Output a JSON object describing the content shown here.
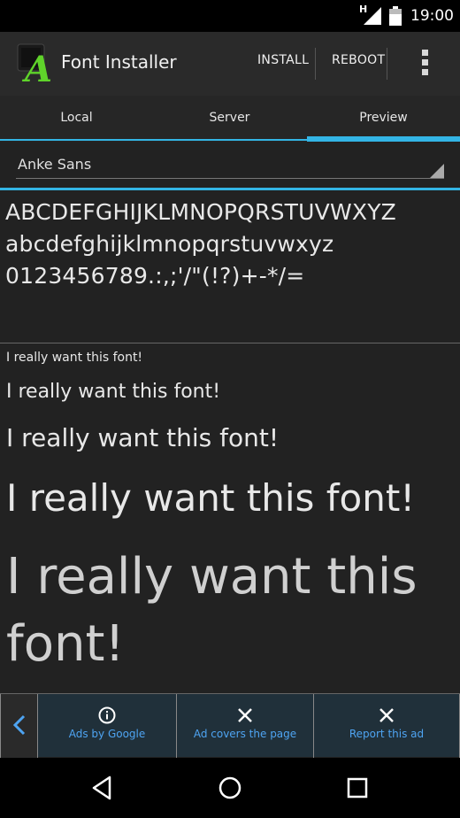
{
  "status_bar": {
    "network": "H",
    "time": "19:00"
  },
  "action_bar": {
    "title": "Font Installer",
    "install_label": "INSTALL",
    "reboot_label": "REBOOT",
    "logo_icon": "font-installer-a-icon",
    "overflow_icon": "overflow-menu-icon"
  },
  "tabs": [
    {
      "label": "Local"
    },
    {
      "label": "Server"
    },
    {
      "label": "Preview"
    }
  ],
  "selected_tab": "Preview",
  "font_selector": {
    "value": "Anke Sans"
  },
  "charset": {
    "uppercase": "ABCDEFGHIJKLMNOPQRSTUVWXYZ",
    "lowercase": "abcdefghijklmnopqrstuvwxyz",
    "digits": "0123456789.:,;'/\"(!?)+-*/="
  },
  "samples": [
    "I really want this font!",
    "I really want this font!",
    "I really want this font!",
    "I really want this font!",
    "I really want this font!"
  ],
  "ad_bar": {
    "ads_by": "Ads by Google",
    "covers": "Ad covers the page",
    "report": "Report this ad"
  },
  "colors": {
    "accent": "#33b5e5",
    "logo_green": "#5fd32a",
    "ad_link": "#4ea4f2"
  }
}
